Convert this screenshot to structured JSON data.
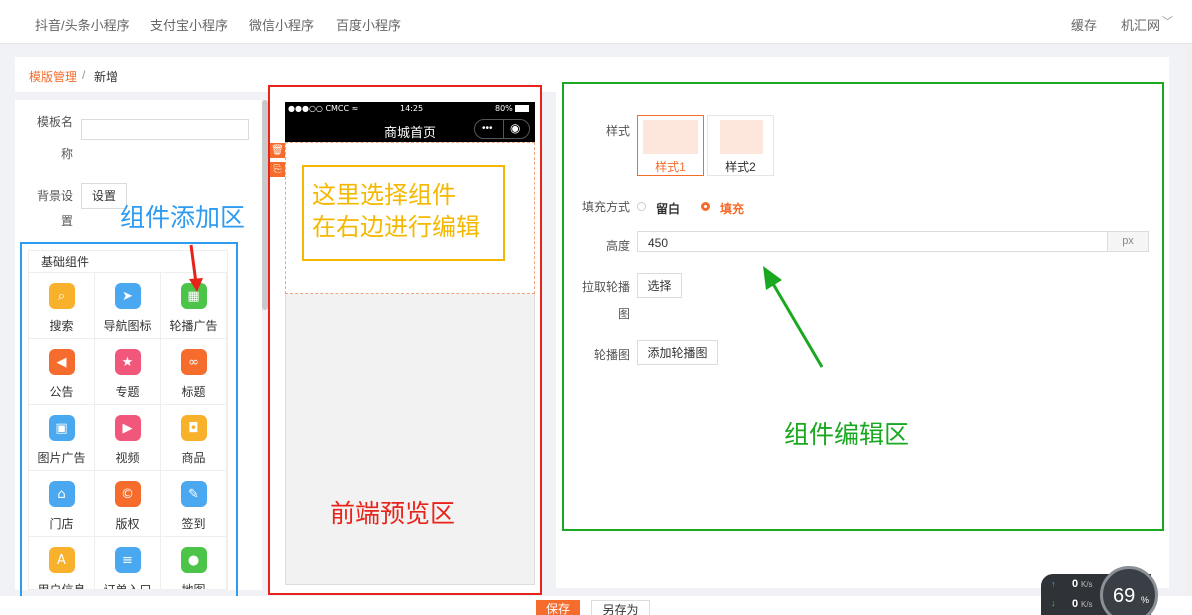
{
  "topbar": {
    "tabs": [
      "抖音/头条小程序",
      "支付宝小程序",
      "微信小程序",
      "百度小程序"
    ],
    "cache": "缓存",
    "user": "机汇网",
    "chevron": "﹀"
  },
  "breadcrumb": {
    "parent": "模版管理",
    "sep": "/",
    "current": "新增"
  },
  "left": {
    "name_label_1": "模板名",
    "name_label_2": "称",
    "bg_label_1": "背景设",
    "bg_label_2": "置",
    "set_button": "设置",
    "section_title": "基础组件",
    "components": [
      {
        "label": "搜索",
        "icon": "search-icon",
        "glyph": "⌕",
        "color": "#f7b12b"
      },
      {
        "label": "导航图标",
        "icon": "navigation-icon",
        "glyph": "➤",
        "color": "#4aa8f0"
      },
      {
        "label": "轮播广告",
        "icon": "carousel-icon",
        "glyph": "▦",
        "color": "#4cc349"
      },
      {
        "label": "公告",
        "icon": "announcement-icon",
        "glyph": "◀",
        "color": "#f56c2d"
      },
      {
        "label": "专题",
        "icon": "topic-icon",
        "glyph": "★",
        "color": "#f0577a"
      },
      {
        "label": "标题",
        "icon": "title-link-icon",
        "glyph": "∞",
        "color": "#f56c2d"
      },
      {
        "label": "图片广告",
        "icon": "image-ad-icon",
        "glyph": "▣",
        "color": "#4aa8f0"
      },
      {
        "label": "视频",
        "icon": "video-icon",
        "glyph": "▶",
        "color": "#f0577a"
      },
      {
        "label": "商品",
        "icon": "goods-icon",
        "glyph": "◘",
        "color": "#f7b12b"
      },
      {
        "label": "门店",
        "icon": "store-icon",
        "glyph": "⌂",
        "color": "#4aa8f0"
      },
      {
        "label": "版权",
        "icon": "copyright-icon",
        "glyph": "©",
        "color": "#f56c2d"
      },
      {
        "label": "签到",
        "icon": "checkin-icon",
        "glyph": "✎",
        "color": "#4aa8f0"
      },
      {
        "label": "用户信息",
        "icon": "user-info-icon",
        "glyph": "A",
        "color": "#f7b12b"
      },
      {
        "label": "订单入口",
        "icon": "order-icon",
        "glyph": "≡",
        "color": "#4aa8f0"
      },
      {
        "label": "地图",
        "icon": "map-icon",
        "glyph": "●",
        "color": "#4cc349"
      }
    ]
  },
  "annotations": {
    "blue": "组件添加区",
    "yellow_line1": "这里选择组件",
    "yellow_line2": "在右边进行编辑",
    "red": "前端预览区",
    "green": "组件编辑区"
  },
  "phone": {
    "carrier": "●●●○○ CMCC ≈",
    "time": "14:25",
    "battery": "80%",
    "title": "商城首页",
    "capsule_more": "•••",
    "capsule_close": "◉",
    "delete_icon": "🗑",
    "copy_icon": "⎘"
  },
  "editor": {
    "style_label": "样式",
    "style_options": [
      "样式1",
      "样式2"
    ],
    "fill_label": "填充方式",
    "fill_options": [
      "留白",
      "填充"
    ],
    "height_label": "高度",
    "height_value": "450",
    "height_unit": "px",
    "pull_label_1": "拉取轮播",
    "pull_label_2": "图",
    "choose_button": "选择",
    "carousel_label": "轮播图",
    "add_carousel_button": "添加轮播图"
  },
  "footer": {
    "save": "保存",
    "save_as": "另存为"
  },
  "network": {
    "up": "0",
    "down": "0",
    "unit": "K/s",
    "percent": "69",
    "percent_sign": "%"
  }
}
